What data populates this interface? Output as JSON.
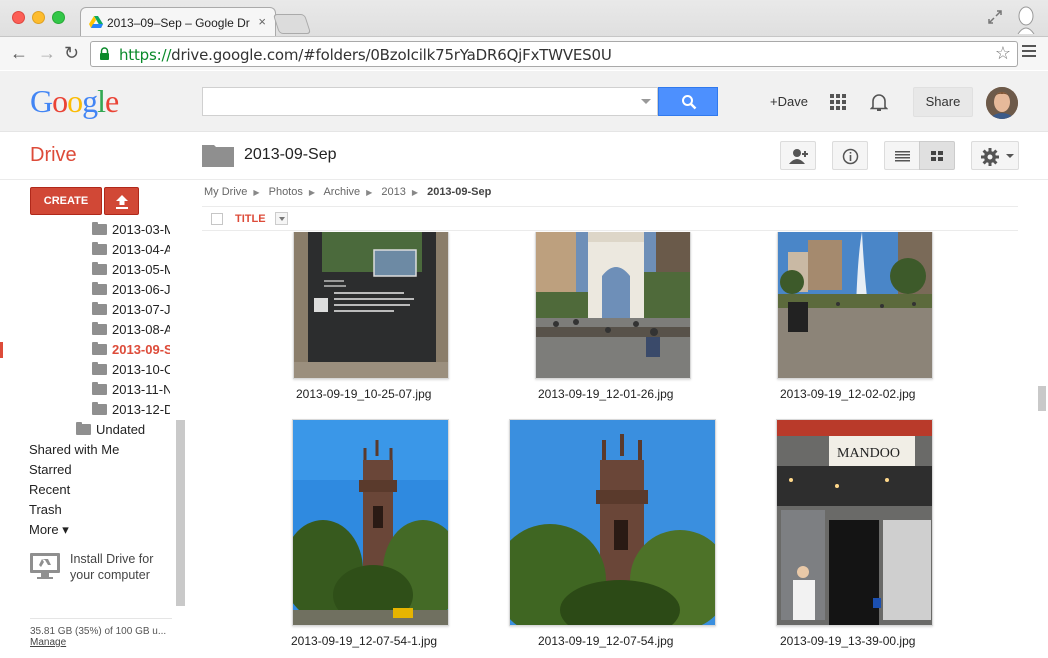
{
  "browser": {
    "tab_title": "2013–09–Sep – Google Dr",
    "url_scheme": "https://",
    "url_rest": "drive.google.com/#folders/0BzoIcilk75rYaDR6QjFxTWVES0U"
  },
  "header": {
    "logo": "Google",
    "user_link": "+Dave",
    "share_label": "Share"
  },
  "app": {
    "title": "Drive",
    "current_folder": "2013-09-Sep"
  },
  "sidebar": {
    "create_label": "CREATE",
    "folders": [
      "2013-03-M",
      "2013-04-A",
      "2013-05-M",
      "2013-06-J",
      "2013-07-J",
      "2013-08-A",
      "2013-09-S",
      "2013-10-C",
      "2013-11-N",
      "2013-12-D"
    ],
    "undated": "Undated",
    "nav": [
      "Shared with Me",
      "Starred",
      "Recent",
      "Trash",
      "More ▾"
    ],
    "install_line1": "Install Drive for",
    "install_line2": "your computer",
    "storage": "35.81 GB (35%) of 100 GB u...",
    "manage": "Manage"
  },
  "breadcrumb": [
    "My Drive",
    "Photos",
    "Archive",
    "2013",
    "2013-09-Sep"
  ],
  "list": {
    "title_col": "TITLE"
  },
  "files": [
    {
      "name": "2013-09-19_10-25-07.jpg",
      "scene": "memorial-sign"
    },
    {
      "name": "2013-09-19_12-01-26.jpg",
      "scene": "washington-arch"
    },
    {
      "name": "2013-09-19_12-02-02.jpg",
      "scene": "fountain"
    },
    {
      "name": "2013-09-19_12-07-54-1.jpg",
      "scene": "church-tower-1"
    },
    {
      "name": "2013-09-19_12-07-54.jpg",
      "scene": "church-tower-2"
    },
    {
      "name": "2013-09-19_13-39-00.jpg",
      "scene": "mandoo-bar"
    }
  ],
  "colors": {
    "accent_red": "#dd4b39",
    "create_red": "#d14836",
    "search_blue": "#4d90fe"
  }
}
